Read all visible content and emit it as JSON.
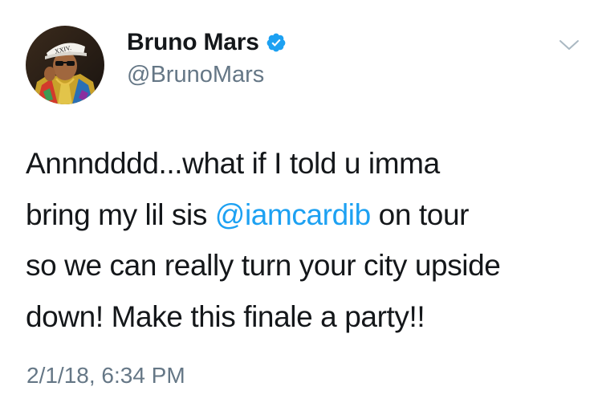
{
  "tweet": {
    "author": {
      "display_name": "Bruno Mars",
      "handle": "@BrunoMars",
      "verified": true,
      "avatar_badge_text": "XXIV."
    },
    "body": {
      "line1": "Annndddd...what if I told u imma",
      "line2_before": "bring my lil sis ",
      "mention": "@iamcardib",
      "line2_after": " on tour",
      "line3": "so we can really turn your city upside",
      "line4": "down! Make this finale a party!!"
    },
    "timestamp": "2/1/18, 6:34 PM",
    "icons": {
      "verified": "verified-badge-icon",
      "menu": "chevron-down-icon"
    },
    "colors": {
      "link": "#1da1f2",
      "secondary_text": "#657786",
      "primary_text": "#14171a",
      "verified": "#1da1f2"
    }
  }
}
